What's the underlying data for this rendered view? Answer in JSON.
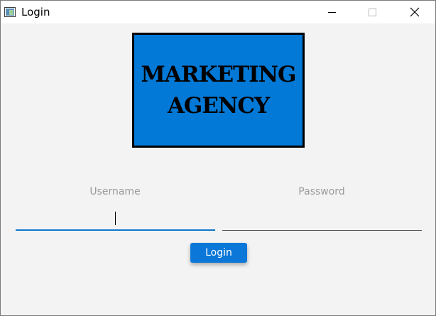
{
  "window": {
    "title": "Login"
  },
  "logo": {
    "line1": "MARKETING",
    "line2": "AGENCY"
  },
  "form": {
    "username_label": "Username",
    "username_value": "",
    "password_label": "Password",
    "password_value": "",
    "login_button": "Login"
  },
  "colors": {
    "accent": "#0b77d8",
    "logo_background": "#0279d6",
    "window_background": "#f3f3f3"
  }
}
